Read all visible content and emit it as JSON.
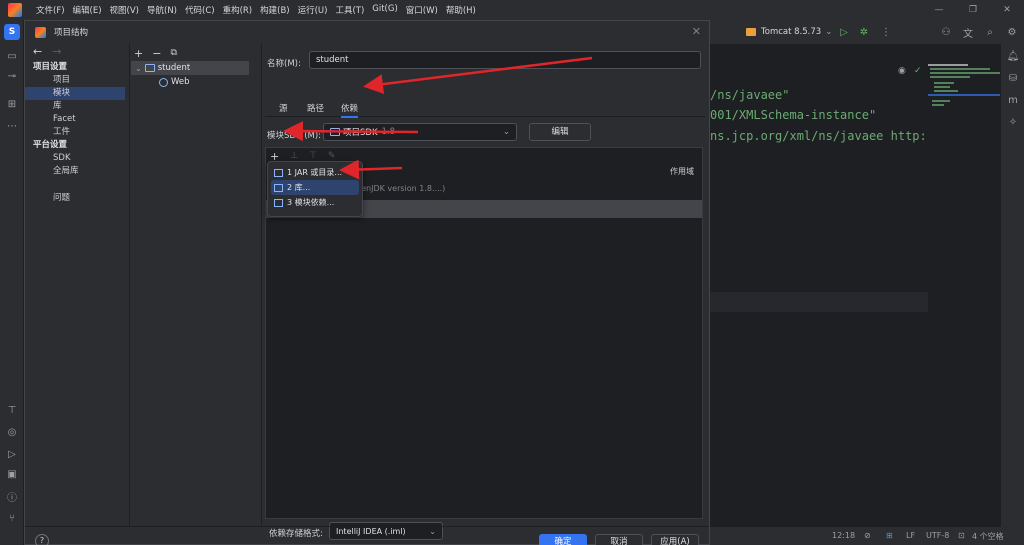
{
  "menubar": {
    "items": [
      "文件(F)",
      "编辑(E)",
      "视图(V)",
      "导航(N)",
      "代码(C)",
      "重构(R)",
      "构建(B)",
      "运行(U)",
      "工具(T)",
      "Git(G)",
      "窗口(W)",
      "帮助(H)"
    ]
  },
  "toolbar": {
    "run_config": "Tomcat 8.5.73"
  },
  "left_strip": {
    "project_badge": "S"
  },
  "editor": {
    "lines": [
      "/ns/javaee\"",
      "001/XMLSchema-instance\"",
      "ns.jcp.org/xml/ns/javaee http:"
    ]
  },
  "status_bar": {
    "time": "12:18",
    "line_sep": "LF",
    "encoding": "UTF-8",
    "indent": "4 个空格"
  },
  "dialog": {
    "title": "项目结构",
    "nav": {
      "project_settings": "项目设置",
      "project_items": [
        "项目",
        "模块",
        "库",
        "Facet",
        "工件"
      ],
      "platform_settings": "平台设置",
      "platform_items": [
        "SDK",
        "全局库"
      ],
      "problems": "问题",
      "selected": "模块"
    },
    "tree": {
      "module": "student",
      "web": "Web"
    },
    "details": {
      "name_label": "名称(M):",
      "name_value": "student",
      "tabs": [
        "源",
        "路径",
        "依赖"
      ],
      "active_tab": "依赖",
      "sdk_label": "模块SDK (M):",
      "sdk_value": "项目SDK",
      "sdk_version": "1.8",
      "edit_button": "编辑",
      "scope_header": "作用域",
      "dep_row_hint": "(enJDK version 1.8....)",
      "format_label": "依赖存储格式:",
      "format_value": "IntelliJ IDEA (.iml)"
    },
    "popup": {
      "items": [
        "1  JAR 或目录...",
        "2  库...",
        "3  模块依赖..."
      ]
    },
    "buttons": {
      "help": "?",
      "ok": "确定",
      "cancel": "取消",
      "apply": "应用(A)"
    }
  },
  "colors": {
    "accent": "#3574f0",
    "annotation_arrow": "#e0262b"
  }
}
